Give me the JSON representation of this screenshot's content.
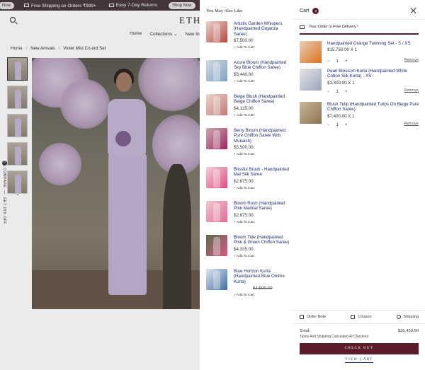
{
  "announcement": {
    "left_pill": "Now",
    "shipping": "Free Shipping on Orders ₹999+",
    "returns": "Easy 7-Day Returns",
    "shop_now": "Shop Now"
  },
  "site": {
    "logo_text": "ETH",
    "nav": [
      "Home",
      "Collections ⌄",
      "New In ⌄"
    ],
    "breadcrumb": [
      "Home",
      "New Arrivals",
      "Violet Mist Co-ord Set"
    ],
    "breadcrumb_sep": "/",
    "compare_label": "COMPARE",
    "side_label": "GET 15% OFF",
    "compare_count": "0"
  },
  "also_like": {
    "title": "You May Also Like",
    "add_label": "+ Add To Cart",
    "items": [
      {
        "name": "Artistic Garden Whispers (Handpainted Organza Saree)",
        "price": "$7,500.00",
        "old_price": "",
        "colors": [
          "#e9d3cc",
          "#b7473f"
        ]
      },
      {
        "name": "Azure Bloom (Handpainted Sky Blue Chiffon Saree)",
        "price": "$5,440.00",
        "old_price": "",
        "colors": [
          "#cfd9e2",
          "#7da3c0"
        ]
      },
      {
        "name": "Beige Blush (Handpainted Beige Chiffon Saree)",
        "price": "$4,125.00",
        "old_price": "",
        "colors": [
          "#e8d6c6",
          "#c47a7a"
        ]
      },
      {
        "name": "Berry Bloom (Handpainted Pure Chiffon Saree With Mukaish)",
        "price": "$5,500.00",
        "old_price": "",
        "colors": [
          "#caa7b0",
          "#a2245e"
        ]
      },
      {
        "name": "Blissful Brush - Handpainted Mal Silk Saree",
        "price": "$2,975.00",
        "old_price": "",
        "colors": [
          "#f3cfd8",
          "#de4d7f"
        ]
      },
      {
        "name": "Bloom Rush (Handpainted Pink Malmal Saree)",
        "price": "$2,975.00",
        "old_price": "",
        "colors": [
          "#f0c7d0",
          "#e26b93"
        ]
      },
      {
        "name": "Bloom Tide (Handpainted Pink & Green Chiffon Saree)",
        "price": "$4,335.00",
        "old_price": "",
        "colors": [
          "#5d6b4a",
          "#d65a87"
        ]
      },
      {
        "name": "Blue Horizon Kurta (Handpainted Blue Ombre Kurta)",
        "price": "",
        "old_price": "$4,500.00",
        "colors": [
          "#dfe6ee",
          "#3d6da2"
        ]
      }
    ]
  },
  "cart": {
    "title": "Cart",
    "count": "3",
    "free_delivery": "Your Order Is Free Delivery !",
    "free_progress": 1.0,
    "remove_label": "Remove",
    "items": [
      {
        "name": "Handpainted Orange Twinning Set - S / XS",
        "price_qty": "$15,750.00 X 1",
        "qty": "1",
        "colors": [
          "#e7d0b9",
          "#e0701e"
        ]
      },
      {
        "name": "Pearl Blossom Kurta (Handpainted White Cotton Silk Kurta) - XS",
        "price_qty": "$3,300.00 X 1",
        "qty": "1",
        "colors": [
          "#e5e4e6",
          "#9aa6bc"
        ]
      },
      {
        "name": "Blush Tulip (Handpainted Tulips On Beige Pure Chiffon Saree)",
        "price_qty": "$7,400.00 X 1",
        "qty": "1",
        "colors": [
          "#c7b79a",
          "#8d7351"
        ]
      }
    ],
    "minus": "−",
    "plus": "+",
    "order_note": "Order Note",
    "coupon": "Coupon",
    "shipping": "Shipping",
    "total_label": "Total:",
    "total_value": "$26,450.00",
    "tax_note": "Taxes And Shipping Calculated At Checkout",
    "checkout": "CHECK OUT",
    "view_cart": "VIEW CART",
    "accent": "#5a1b2b"
  }
}
